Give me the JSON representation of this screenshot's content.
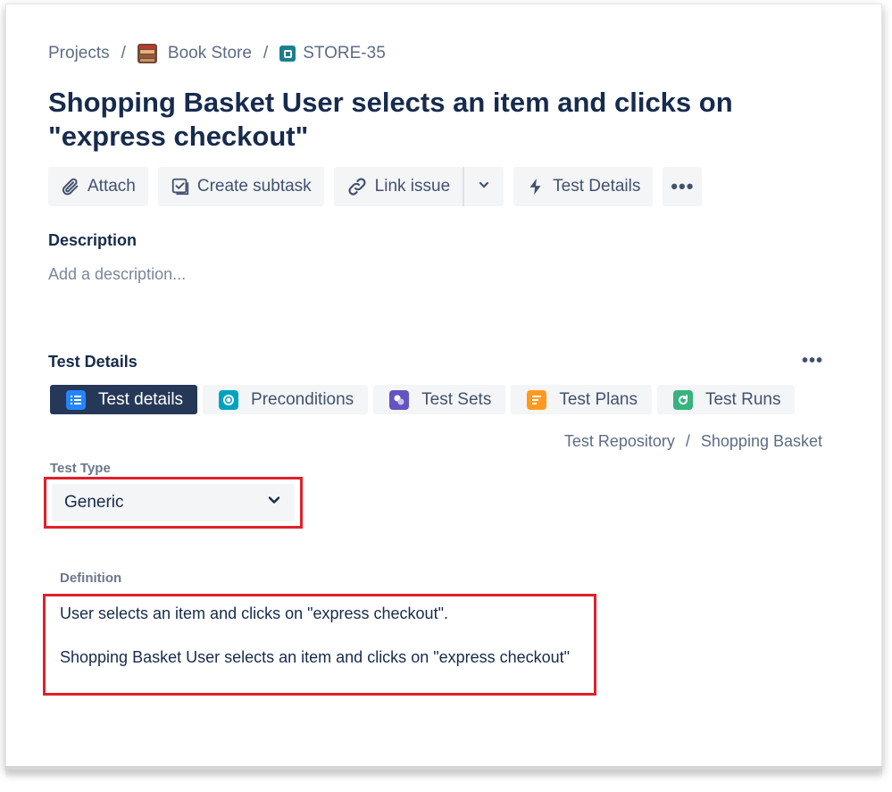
{
  "breadcrumb": {
    "projects": "Projects",
    "separator": "/",
    "project": "Book Store",
    "issue_key": "STORE-35"
  },
  "issue": {
    "title": "Shopping Basket User selects an item and clicks on \"express checkout\""
  },
  "toolbar": {
    "attach": "Attach",
    "create_subtask": "Create subtask",
    "link_issue": "Link issue",
    "test_details": "Test Details",
    "more": "•••"
  },
  "description": {
    "label": "Description",
    "placeholder": "Add a description..."
  },
  "test_details": {
    "label": "Test Details",
    "more": "•••",
    "tabs": [
      {
        "label": "Test details",
        "icon": "list-icon",
        "color": "#2684ff"
      },
      {
        "label": "Preconditions",
        "icon": "precondition-icon",
        "color": "#00a3bf"
      },
      {
        "label": "Test Sets",
        "icon": "test-sets-icon",
        "color": "#6554c0"
      },
      {
        "label": "Test Plans",
        "icon": "test-plans-icon",
        "color": "#ff991f"
      },
      {
        "label": "Test Runs",
        "icon": "test-runs-icon",
        "color": "#36b37e"
      }
    ],
    "repository_path": {
      "root": "Test Repository",
      "separator": "/",
      "folder": "Shopping Basket"
    },
    "test_type": {
      "label": "Test Type",
      "value": "Generic"
    },
    "definition": {
      "label": "Definition",
      "lines": [
        "User selects an item and clicks on \"express checkout\".",
        "Shopping Basket User selects an item and clicks on \"express checkout\""
      ]
    }
  },
  "colors": {
    "highlight": "#e0202b",
    "active_tab": "#253858",
    "text": "#172b4d",
    "subtle_text": "#5e6c84"
  }
}
